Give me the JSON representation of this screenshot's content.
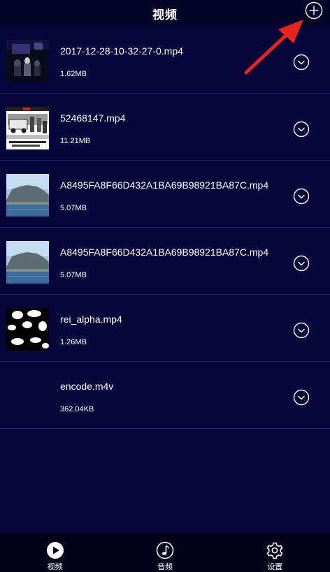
{
  "header": {
    "title": "视频",
    "add_icon": "plus-circle-icon"
  },
  "videos": [
    {
      "name": "2017-12-28-10-32-27-0.mp4",
      "size": "1.62MB",
      "thumbnail": "dark-concert-scene"
    },
    {
      "name": "52468147.mp4",
      "size": "11.21MB",
      "thumbnail": "street-car-scene"
    },
    {
      "name": "A8495FA8F66D432A1BA69B98921BA87C.mp4",
      "size": "5.07MB",
      "thumbnail": "mountain-coast"
    },
    {
      "name": "A8495FA8F66D432A1BA69B98921BA87C.mp4",
      "size": "5.07MB",
      "thumbnail": "mountain-coast"
    },
    {
      "name": "rei_alpha.mp4",
      "size": "1.26MB",
      "thumbnail": "black-white-blobs"
    },
    {
      "name": "encode.m4v",
      "size": "362.04KB",
      "thumbnail": "none"
    }
  ],
  "tabs": [
    {
      "label": "视频",
      "icon": "play-circle-icon",
      "active": true
    },
    {
      "label": "音频",
      "icon": "music-note-icon",
      "active": false
    },
    {
      "label": "设置",
      "icon": "gear-icon",
      "active": false
    }
  ],
  "colors": {
    "background": "#06063a",
    "header": "#040426",
    "divider": "#1c1c70",
    "tabbar": "#020218",
    "annotation_arrow": "#e8241c"
  }
}
